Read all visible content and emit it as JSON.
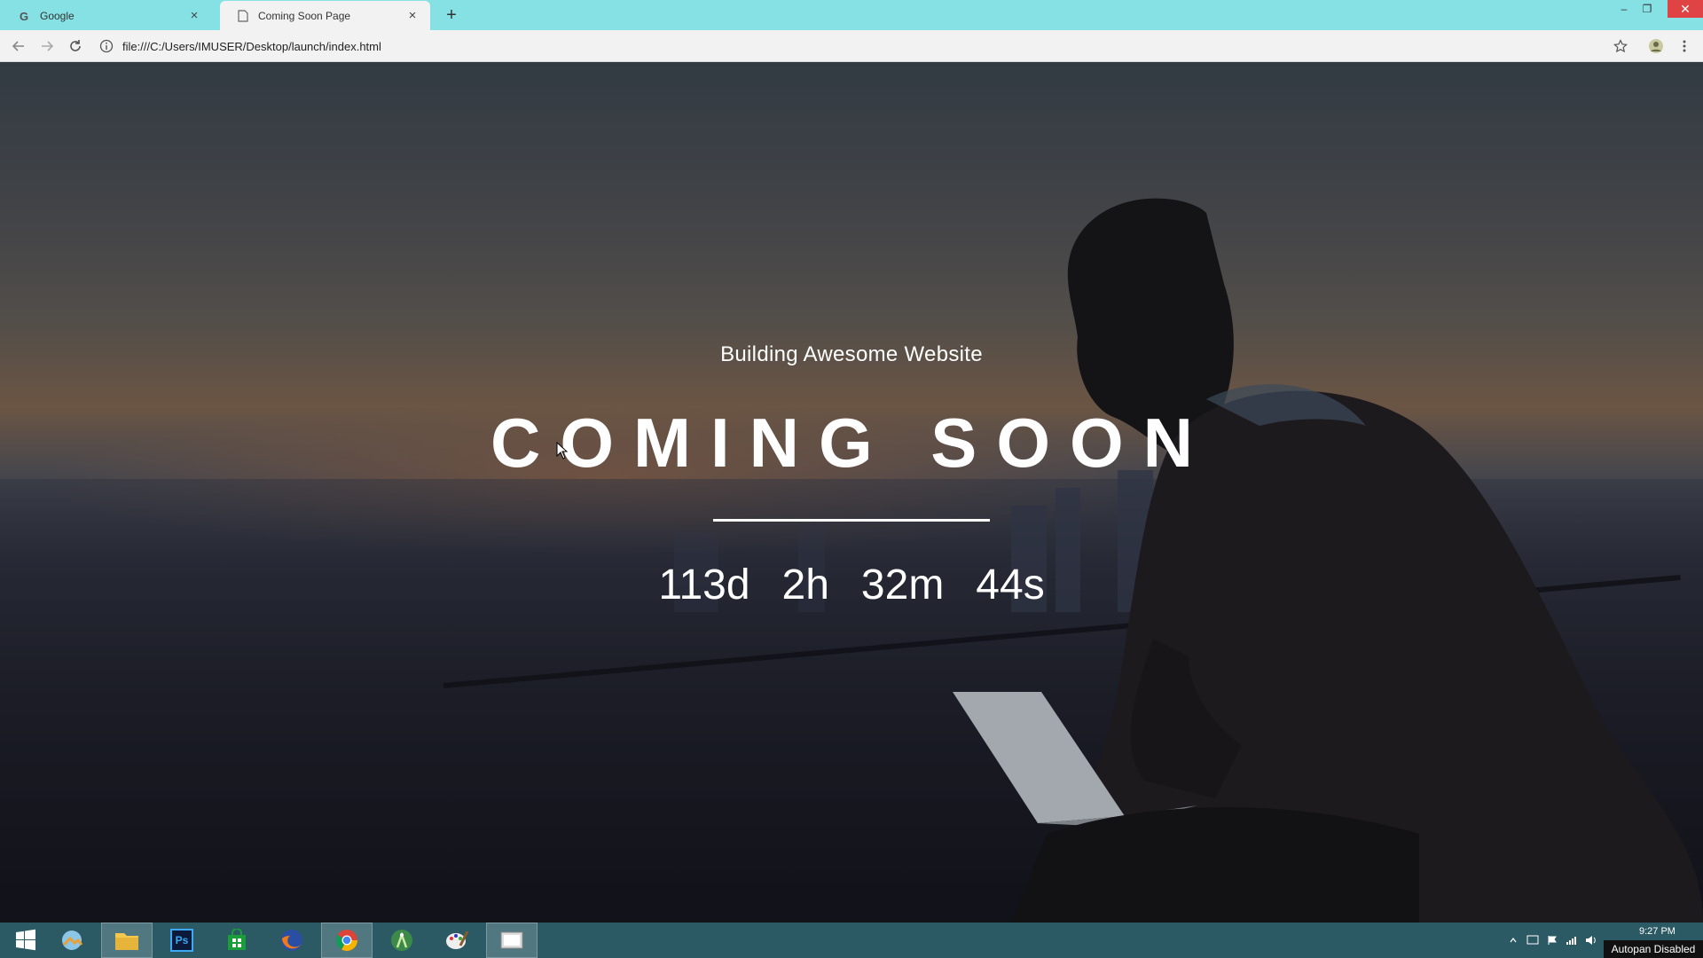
{
  "browser": {
    "tabs": [
      {
        "title": "Google",
        "icon": "google-g-icon",
        "active": false
      },
      {
        "title": "Coming Soon Page",
        "icon": "document-icon",
        "active": true
      }
    ],
    "new_tab_label": "+",
    "address_url": "file:///C:/Users/IMUSER/Desktop/launch/index.html"
  },
  "page": {
    "tagline": "Building Awesome Website",
    "headline": "COMING SOON",
    "countdown": {
      "days": "113d",
      "hours": "2h",
      "minutes": "32m",
      "seconds": "44s"
    }
  },
  "taskbar": {
    "apps": [
      "windows-start-icon",
      "photo-viewer-icon",
      "file-explorer-icon",
      "photoshop-icon",
      "store-icon",
      "firefox-icon",
      "chrome-icon",
      "android-studio-icon",
      "paint-icon",
      "screen-recorder-icon"
    ],
    "photoshop_label": "Ps",
    "clock": "9:27 PM",
    "autopan": "Autopan Disabled"
  },
  "colors": {
    "tabstrip": "#86e1e4",
    "taskbar": "#2b5a64",
    "close_button": "#e04343"
  }
}
